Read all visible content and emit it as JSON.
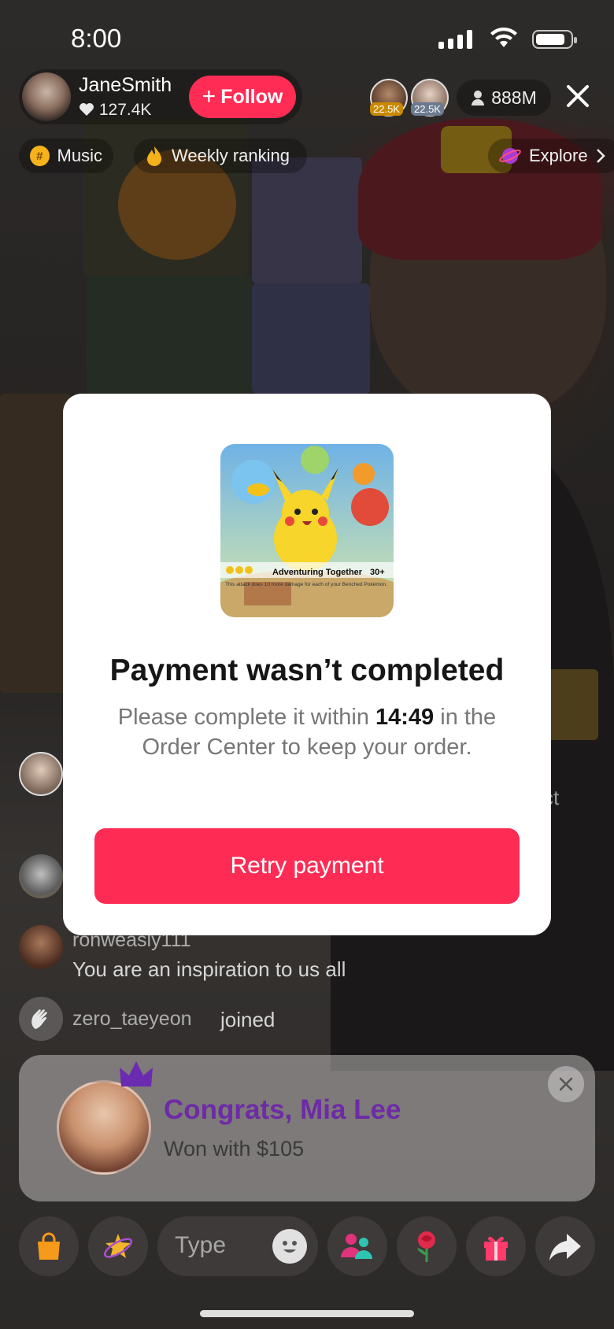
{
  "status_bar": {
    "time": "8:00"
  },
  "host": {
    "name": "JaneSmith",
    "likes": "127.4K",
    "follow_label": "Follow"
  },
  "top_viewers": [
    {
      "badge": "22.5K",
      "badge_color": "#e0a100"
    },
    {
      "badge": "22.5K",
      "badge_color": "#7a8aa0"
    }
  ],
  "viewer_count": "888M",
  "chips": {
    "music": "Music",
    "weekly": "Weekly ranking",
    "explore": "Explore"
  },
  "chat": [
    {
      "user": "ronweasly111",
      "message": "You are an inspiration to us all"
    },
    {
      "user": "zero_taeyeon",
      "message": "joined"
    }
  ],
  "chat_partial_text": "ct",
  "winner": {
    "title": "Congrats, Mia Lee",
    "subtitle": "Won with $105"
  },
  "input": {
    "placeholder": "Type"
  },
  "modal": {
    "product_text": "Adventuring Together",
    "product_damage": "30+",
    "product_desc": "This attack does 10 more damage for each of your Benched Pokémon.",
    "title": "Payment wasn’t completed",
    "body_before": "Please complete it within ",
    "countdown": "14:49",
    "body_after": " in the Order Center to keep your order.",
    "retry_label": "Retry payment"
  },
  "colors": {
    "accent": "#fe2c55",
    "winner_title": "#6e2ba6",
    "crown": "#6a2bb0"
  },
  "icons": [
    "heart-icon",
    "plus-icon",
    "person-icon",
    "close-icon",
    "hashtag-icon",
    "flame-icon",
    "planet-icon",
    "chevron-right-icon",
    "shopping-bag-icon",
    "sparkle-star-icon",
    "smiley-icon",
    "people-icon",
    "rose-icon",
    "gift-icon",
    "share-arrow-icon",
    "crown-icon",
    "wave-hand-icon"
  ]
}
